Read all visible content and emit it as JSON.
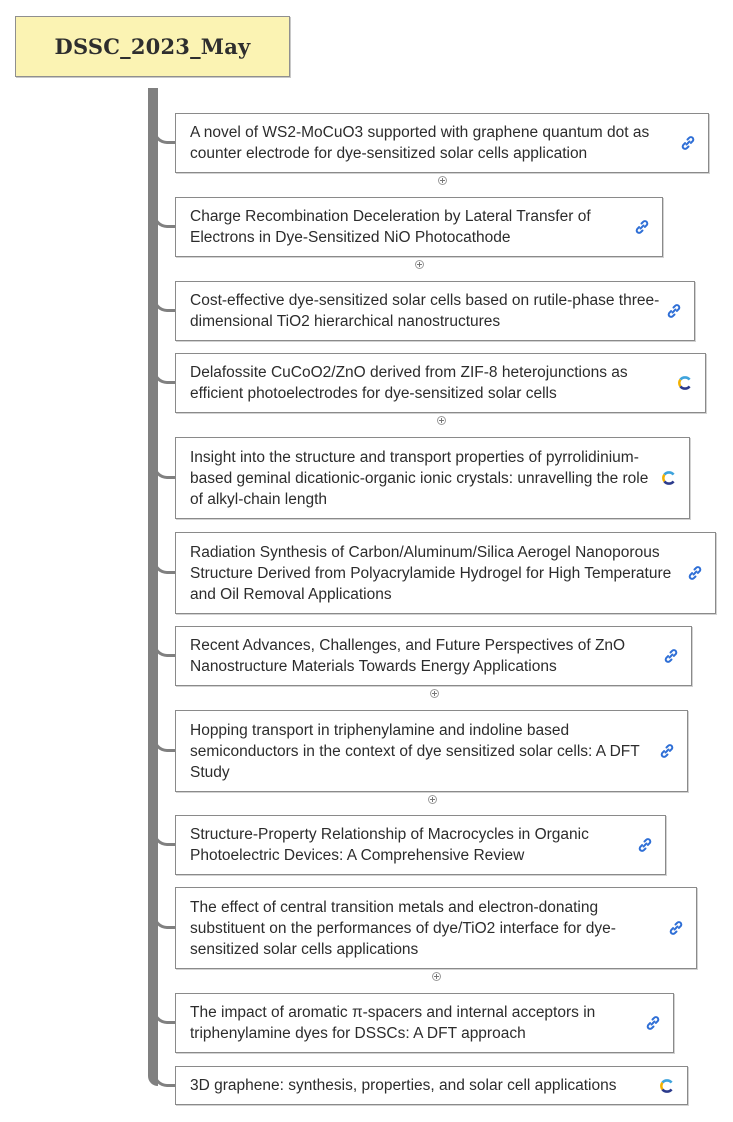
{
  "map": {
    "title": "DSSC_2023_May",
    "nodes": [
      {
        "label": "A novel of WS2-MoCuO3 supported with graphene quantum dot as counter electrode for dye-sensitized solar cells application",
        "icon": "link-icon",
        "collapsed": true
      },
      {
        "label": "Charge Recombination Deceleration by Lateral Transfer of Electrons in Dye-Sensitized NiO Photocathode",
        "icon": "link-icon",
        "collapsed": true
      },
      {
        "label": "Cost-effective dye-sensitized solar cells based on rutile-phase three-dimensional TiO2 hierarchical nanostructures",
        "icon": "link-icon",
        "collapsed": false
      },
      {
        "label": "Delafossite CuCoO2/ZnO derived from ZIF-8 heterojunctions as efficient photoelectrodes for dye-sensitized solar cells",
        "icon": "crossref-icon",
        "collapsed": true
      },
      {
        "label": "Insight into the structure and transport properties of pyrrolidinium-based geminal dicationic-organic ionic crystals: unravelling the role of alkyl-chain length",
        "icon": "crossref-icon",
        "collapsed": false
      },
      {
        "label": "Radiation Synthesis of Carbon/Aluminum/Silica Aerogel Nanoporous Structure Derived from Polyacrylamide Hydrogel for High Temperature and Oil Removal Applications",
        "icon": "link-icon",
        "collapsed": false
      },
      {
        "label": "Recent Advances, Challenges, and Future Perspectives of ZnO Nanostructure Materials Towards Energy Applications",
        "icon": "link-icon",
        "collapsed": true
      },
      {
        "label": "Hopping transport in triphenylamine and indoline based semiconductors in the context of dye sensitized solar cells: A DFT Study",
        "icon": "link-icon",
        "collapsed": true
      },
      {
        "label": "Structure-Property Relationship of Macrocycles in Organic Photoelectric Devices: A Comprehensive Review",
        "icon": "link-icon",
        "collapsed": false
      },
      {
        "label": "The effect of central transition metals and electron-donating substituent on the performances of dye/TiO2 interface for dye-sensitized solar cells applications",
        "icon": "link-icon",
        "collapsed": true
      },
      {
        "label": "The impact of aromatic π-spacers and internal acceptors in triphenylamine dyes for DSSCs: A DFT approach",
        "icon": "link-icon",
        "collapsed": false
      },
      {
        "label": "3D graphene: synthesis, properties, and solar cell applications",
        "icon": "crossref-icon",
        "collapsed": false
      }
    ]
  }
}
